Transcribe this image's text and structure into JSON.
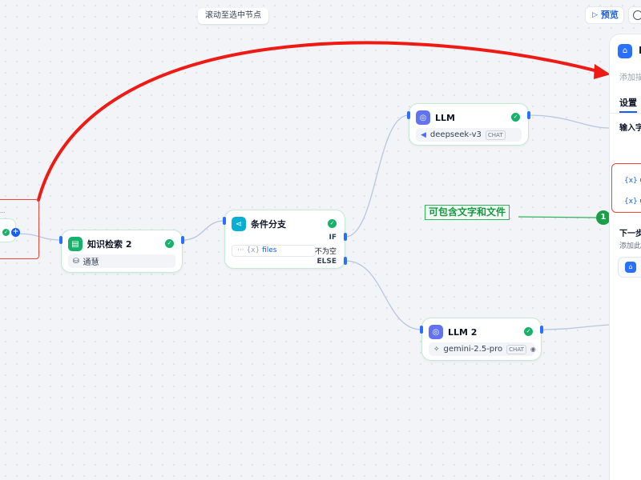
{
  "toolbar": {
    "scroll_to_selected": "滚动至选中节点",
    "preview_label": "预览",
    "play_icon": "play-icon",
    "history_icon": "clock-icon"
  },
  "left_node": {
    "toolbar_text": "' ...",
    "add_icon": "plus-icon"
  },
  "nodes": {
    "knowledge": {
      "title": "知识检索 2",
      "dataset": "通慧",
      "icon": "book-icon",
      "color": "#17b26a"
    },
    "condition": {
      "title": "条件分支",
      "if_label": "IF",
      "variable": "files",
      "operator": "不为空",
      "else_label": "ELSE",
      "icon": "branch-icon",
      "color": "#06aed4"
    },
    "llm1": {
      "title": "LLM",
      "model": "deepseek-v3",
      "mode": "CHAT",
      "icon": "llm-icon",
      "color": "#6172f3"
    },
    "llm2": {
      "title": "LLM 2",
      "model": "gemini-2.5-pro",
      "mode": "CHAT",
      "icon": "llm-icon",
      "color": "#6172f3"
    }
  },
  "annotation": {
    "text": "可包含文字和文件",
    "badge": "1",
    "color": "#1a9e48"
  },
  "panel": {
    "title": "",
    "title_partial": "E",
    "description_partial": "添加描",
    "tab_settings": "设置",
    "input_label_partial": "输入字",
    "var_1_partial": "u",
    "var_2_partial": "u",
    "next_step_partial": "下一步",
    "next_step_desc_partial": "添加此",
    "icon": "home-icon"
  },
  "colors": {
    "accent": "#155eef",
    "success": "#17b26a",
    "highlight_red": "#f04438"
  }
}
